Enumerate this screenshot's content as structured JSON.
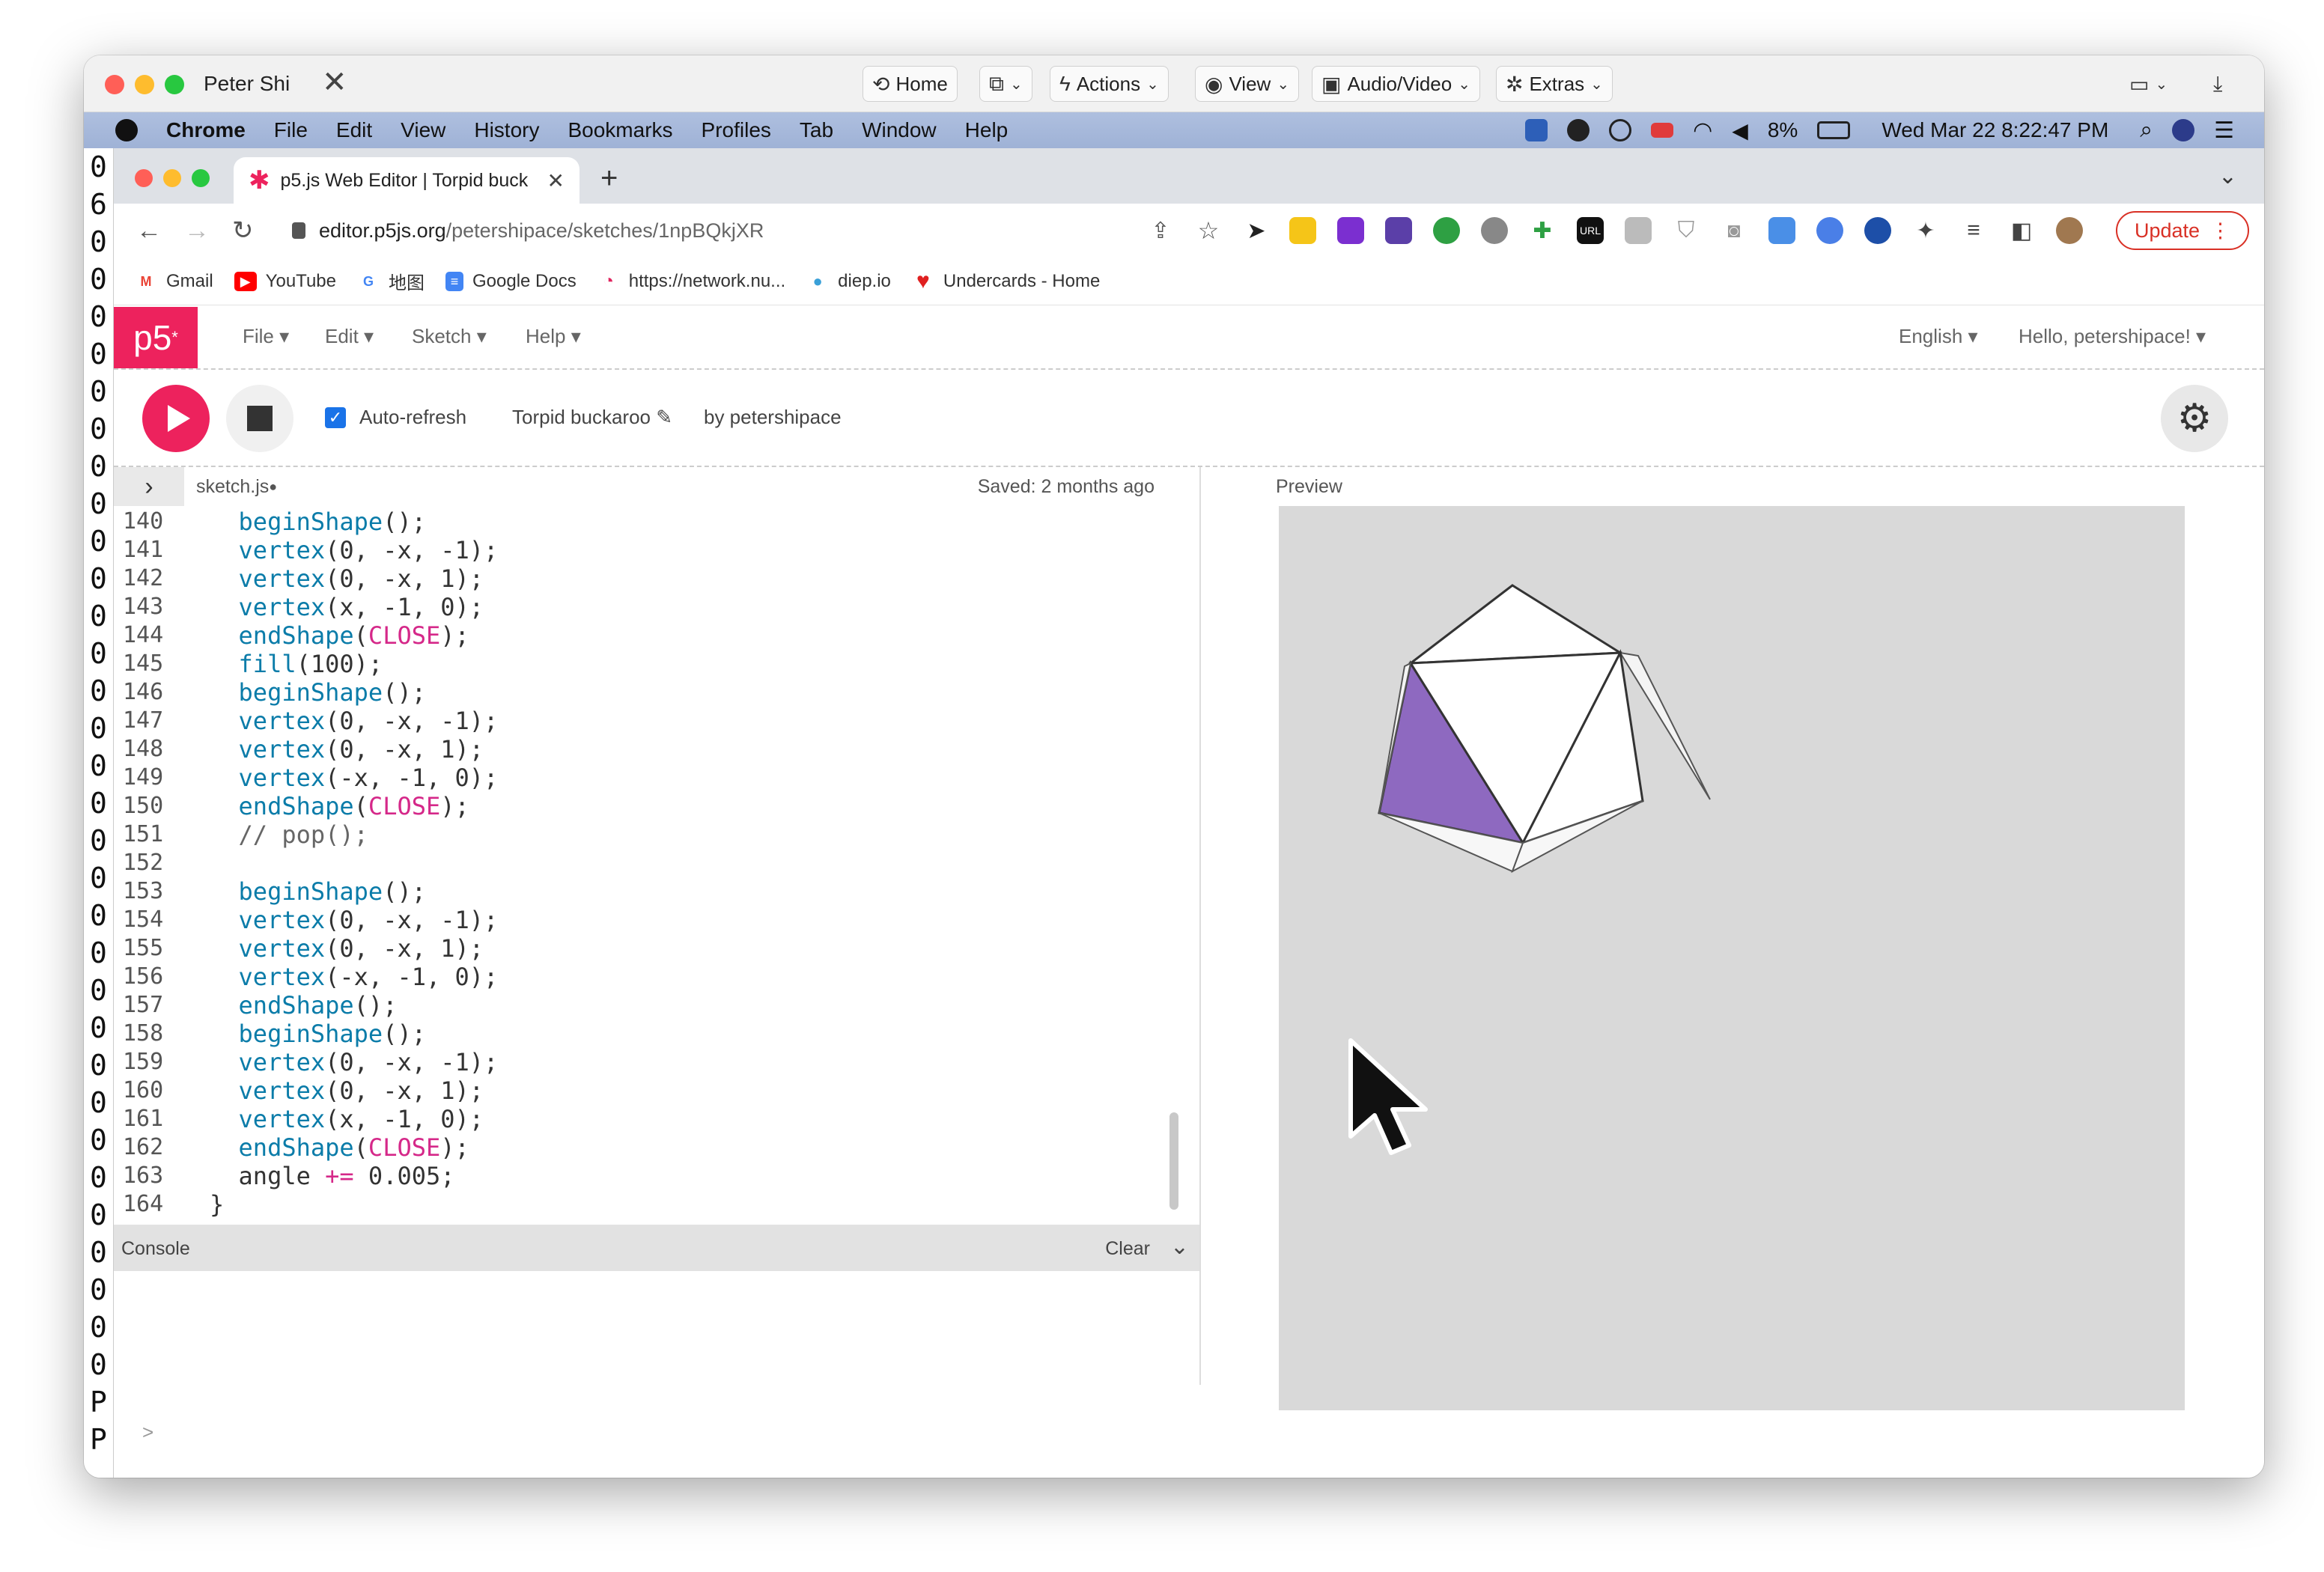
{
  "remote": {
    "user": "Peter Shi",
    "buttons": [
      {
        "label": "Home",
        "icon": "home-icon"
      },
      {
        "label": "",
        "icon": "clipboard-icon"
      },
      {
        "label": "Actions",
        "icon": "lightning-icon"
      },
      {
        "label": "View",
        "icon": "eye-icon"
      },
      {
        "label": "Audio/Video",
        "icon": "chat-icon"
      },
      {
        "label": "Extras",
        "icon": "tools-icon"
      }
    ]
  },
  "menubar": {
    "app": "Chrome",
    "items": [
      "File",
      "Edit",
      "View",
      "History",
      "Bookmarks",
      "Profiles",
      "Tab",
      "Window",
      "Help"
    ],
    "battery": "8%",
    "clock": "Wed Mar 22  8:22:47 PM"
  },
  "strip": {
    "chars": [
      "0",
      "6",
      "0",
      "0",
      "0",
      "0",
      "0",
      "0",
      "0",
      "0",
      "0",
      "0",
      "0",
      "0",
      "0",
      "0",
      "0",
      "0",
      "0",
      "0",
      "0",
      "0",
      "0",
      "0",
      "0",
      "0",
      "0",
      "0",
      "0",
      "0",
      "0",
      "0",
      "0",
      "P",
      "P"
    ]
  },
  "browser": {
    "tab_title": "p5.js Web Editor | Torpid buck",
    "url_host": "editor.p5js.org",
    "url_path": "/petershipace/sketches/1npBQkjXR",
    "update_label": "Update",
    "bookmarks": [
      "Gmail",
      "YouTube",
      "地图",
      "Google Docs",
      "https://network.nu...",
      "diep.io",
      "Undercards - Home"
    ]
  },
  "p5": {
    "logo": "p5",
    "menus": [
      "File",
      "Edit",
      "Sketch",
      "Help"
    ],
    "language": "English",
    "greeting": "Hello, petershipace!",
    "auto_refresh": "Auto-refresh",
    "sketch_name": "Torpid buckaroo",
    "author": "by petershipace",
    "file_name": "sketch.js",
    "saved": "Saved: 2 months ago",
    "preview_label": "Preview",
    "console_label": "Console",
    "clear_label": "Clear",
    "console_prompt": ">"
  },
  "code_lines": [
    {
      "n": "140",
      "t": "  beginShape();"
    },
    {
      "n": "141",
      "t": "  vertex(0, -x, -1);"
    },
    {
      "n": "142",
      "t": "  vertex(0, -x, 1);"
    },
    {
      "n": "143",
      "t": "  vertex(x, -1, 0);"
    },
    {
      "n": "144",
      "t": "  endShape(CLOSE);"
    },
    {
      "n": "145",
      "t": "  fill(100);"
    },
    {
      "n": "146",
      "t": "  beginShape();"
    },
    {
      "n": "147",
      "t": "  vertex(0, -x, -1);"
    },
    {
      "n": "148",
      "t": "  vertex(0, -x, 1);"
    },
    {
      "n": "149",
      "t": "  vertex(-x, -1, 0);"
    },
    {
      "n": "150",
      "t": "  endShape(CLOSE);"
    },
    {
      "n": "151",
      "t": "  // pop();"
    },
    {
      "n": "152",
      "t": ""
    },
    {
      "n": "153",
      "t": "  beginShape();"
    },
    {
      "n": "154",
      "t": "  vertex(0, -x, -1);"
    },
    {
      "n": "155",
      "t": "  vertex(0, -x, 1);"
    },
    {
      "n": "156",
      "t": "  vertex(-x, -1, 0);"
    },
    {
      "n": "157",
      "t": "  endShape();"
    },
    {
      "n": "158",
      "t": "  beginShape();"
    },
    {
      "n": "159",
      "t": "  vertex(0, -x, -1);"
    },
    {
      "n": "160",
      "t": "  vertex(0, -x, 1);"
    },
    {
      "n": "161",
      "t": "  vertex(x, -1, 0);"
    },
    {
      "n": "162",
      "t": "  endShape(CLOSE);"
    },
    {
      "n": "163",
      "t": "  angle += 0.005;"
    },
    {
      "n": "164",
      "t": "}"
    }
  ],
  "colors": {
    "p5_pink": "#ed225d",
    "keyword": "#0b7ca9",
    "constant": "#d52889",
    "face_purple": "#8e69c0",
    "canvas_bg": "#d9d9d9"
  }
}
